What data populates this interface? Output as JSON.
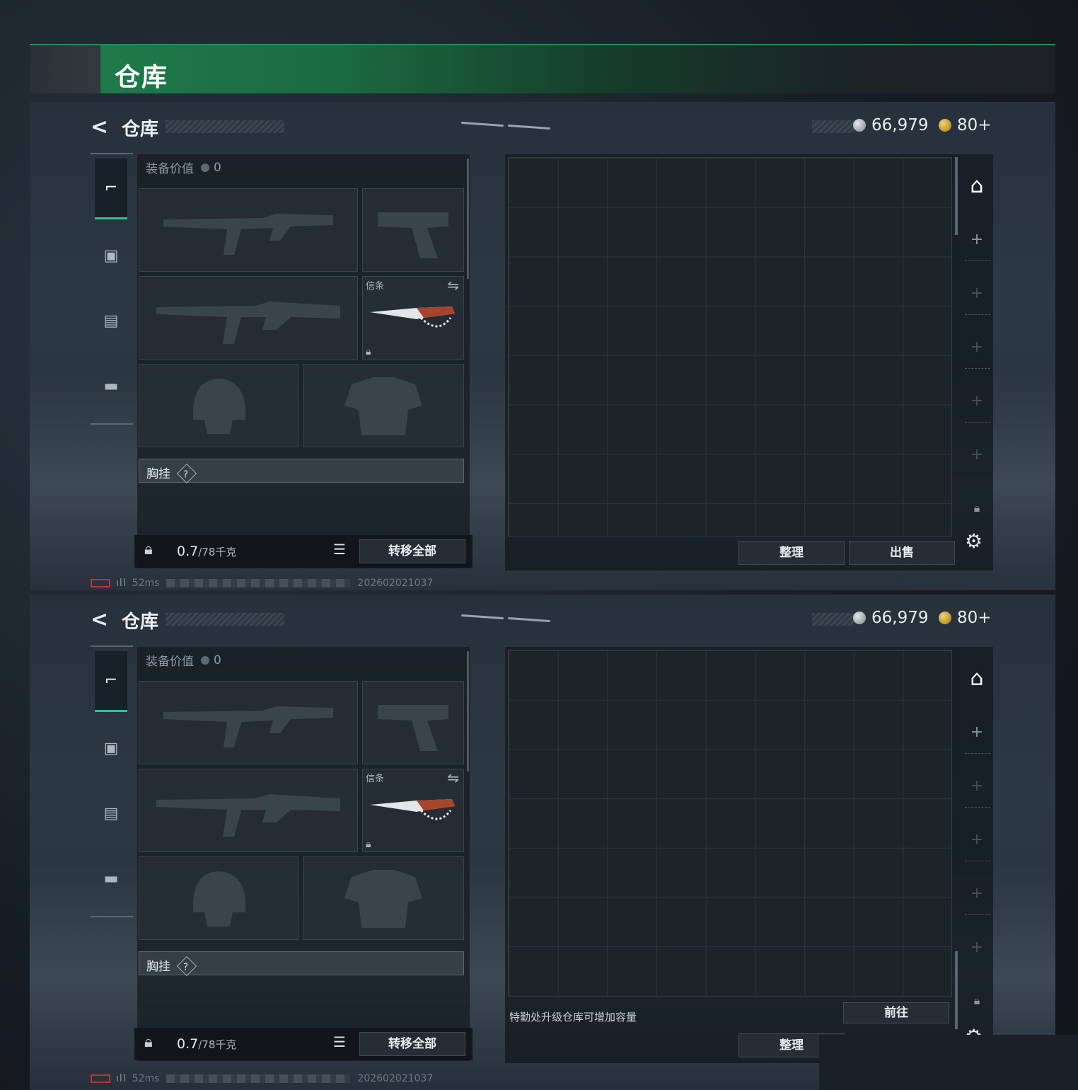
{
  "page": {
    "title": "仓库"
  },
  "screens": [
    {
      "header": {
        "back_icon": "chevron-left-icon",
        "title": "仓库",
        "silver": "66,979",
        "gold": "80+"
      },
      "categories": [
        "pistol-icon",
        "backpack-icon",
        "medkit-icon",
        "toolbox-icon"
      ],
      "equip": {
        "value_label": "装备价值",
        "value": "0",
        "slot_label": "信条",
        "chest_label": "胸挂",
        "chest_help": "?",
        "weight": "0.7",
        "weight_cap": "/78千克",
        "transfer_all": "转移全部"
      },
      "grid": {
        "sort": "整理",
        "sell": "出售",
        "upgrade_note": "",
        "goto": ""
      },
      "status": {
        "ping": "52ms",
        "build": "202602021037"
      }
    },
    {
      "header": {
        "back_icon": "chevron-left-icon",
        "title": "仓库",
        "silver": "66,979",
        "gold": "80+"
      },
      "categories": [
        "pistol-icon",
        "backpack-icon",
        "medkit-icon",
        "toolbox-icon"
      ],
      "equip": {
        "value_label": "装备价值",
        "value": "0",
        "slot_label": "信条",
        "chest_label": "胸挂",
        "chest_help": "?",
        "weight": "0.7",
        "weight_cap": "/78千克",
        "transfer_all": "转移全部"
      },
      "grid": {
        "sort": "整理",
        "sell": "",
        "upgrade_note": "特勤处升级仓库可增加容量",
        "goto": "前往"
      },
      "status": {
        "ping": "52ms",
        "build": "202602021037"
      }
    }
  ]
}
